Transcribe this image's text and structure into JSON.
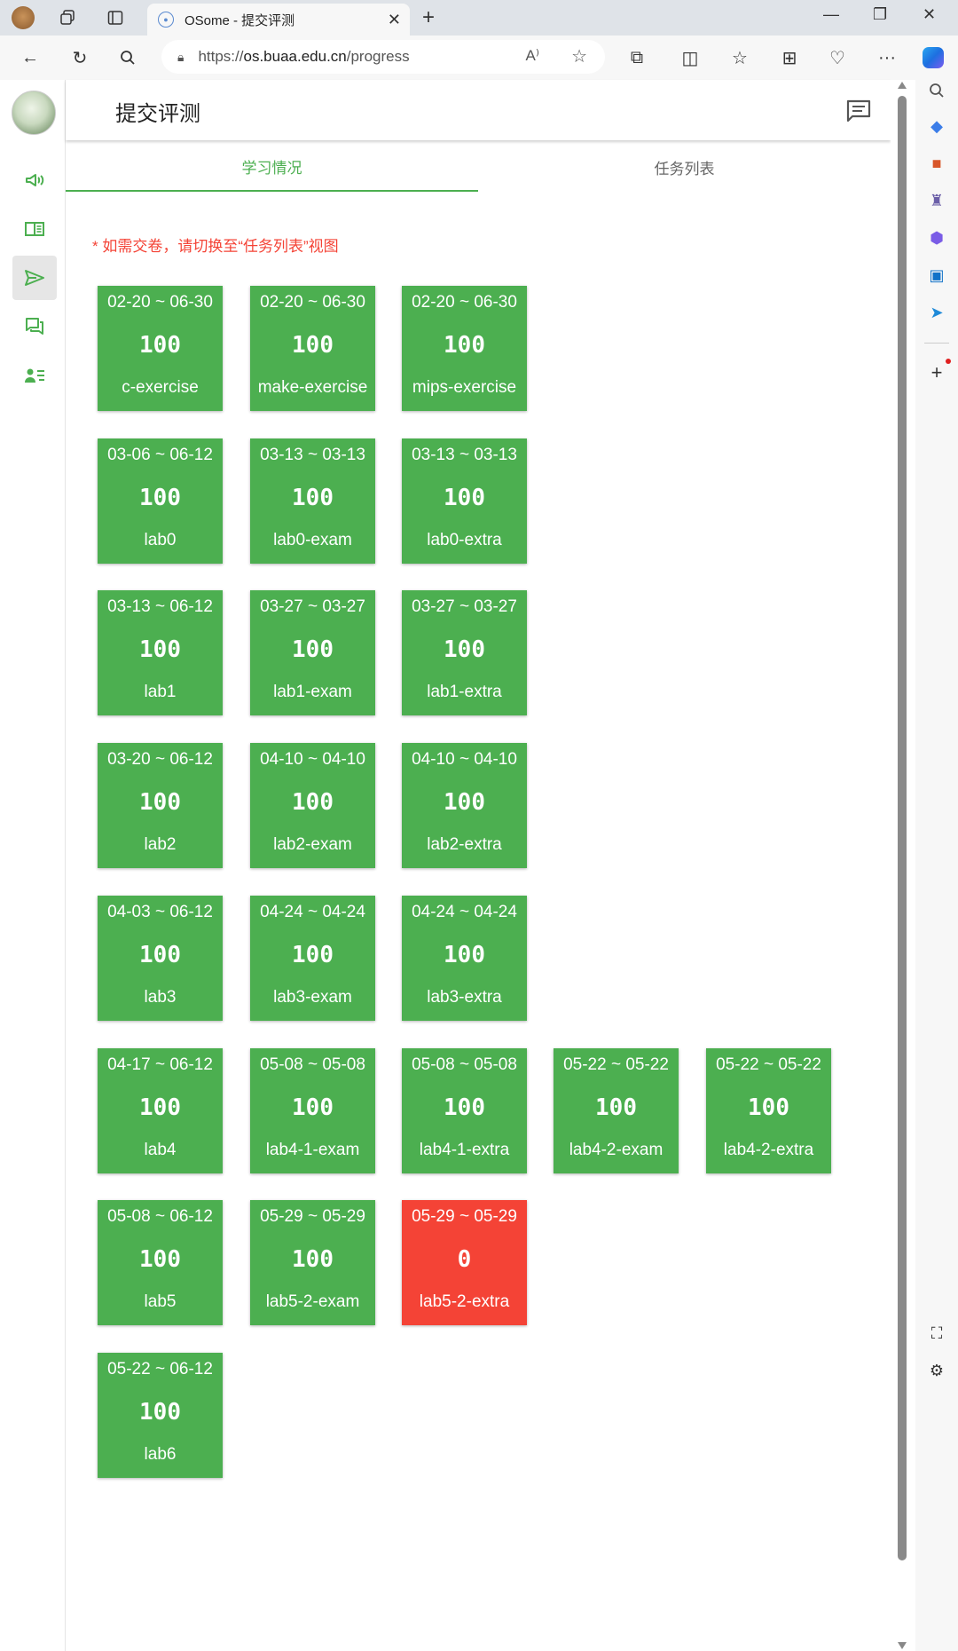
{
  "browser": {
    "tab_title": "OSome - 提交评测",
    "url_prefix": "https://",
    "url_host": "os.buaa.edu.cn",
    "url_path": "/progress"
  },
  "app": {
    "title": "提交评测",
    "tabs": [
      {
        "label": "学习情况",
        "active": true
      },
      {
        "label": "任务列表",
        "active": false
      }
    ],
    "notice": "* 如需交卷，请切换至“任务列表”视图"
  },
  "nav": [
    "announcement-icon",
    "book-icon",
    "send-icon",
    "forum-icon",
    "user-list-icon"
  ],
  "colors": {
    "pass": "#4caf50",
    "fail": "#f44336"
  },
  "cards": [
    {
      "date": "02-20 ~ 06-30",
      "score": "100",
      "name": "c-exercise",
      "status": "pass"
    },
    {
      "date": "02-20 ~ 06-30",
      "score": "100",
      "name": "make-exercise",
      "status": "pass"
    },
    {
      "date": "02-20 ~ 06-30",
      "score": "100",
      "name": "mips-exercise",
      "status": "pass"
    },
    {
      "date": "03-06 ~ 06-12",
      "score": "100",
      "name": "lab0",
      "status": "pass"
    },
    {
      "date": "03-13 ~ 03-13",
      "score": "100",
      "name": "lab0-exam",
      "status": "pass"
    },
    {
      "date": "03-13 ~ 03-13",
      "score": "100",
      "name": "lab0-extra",
      "status": "pass"
    },
    {
      "date": "03-13 ~ 06-12",
      "score": "100",
      "name": "lab1",
      "status": "pass"
    },
    {
      "date": "03-27 ~ 03-27",
      "score": "100",
      "name": "lab1-exam",
      "status": "pass"
    },
    {
      "date": "03-27 ~ 03-27",
      "score": "100",
      "name": "lab1-extra",
      "status": "pass"
    },
    {
      "date": "03-20 ~ 06-12",
      "score": "100",
      "name": "lab2",
      "status": "pass"
    },
    {
      "date": "04-10 ~ 04-10",
      "score": "100",
      "name": "lab2-exam",
      "status": "pass"
    },
    {
      "date": "04-10 ~ 04-10",
      "score": "100",
      "name": "lab2-extra",
      "status": "pass"
    },
    {
      "date": "04-03 ~ 06-12",
      "score": "100",
      "name": "lab3",
      "status": "pass"
    },
    {
      "date": "04-24 ~ 04-24",
      "score": "100",
      "name": "lab3-exam",
      "status": "pass"
    },
    {
      "date": "04-24 ~ 04-24",
      "score": "100",
      "name": "lab3-extra",
      "status": "pass"
    },
    {
      "date": "04-17 ~ 06-12",
      "score": "100",
      "name": "lab4",
      "status": "pass"
    },
    {
      "date": "05-08 ~ 05-08",
      "score": "100",
      "name": "lab4-1-exam",
      "status": "pass"
    },
    {
      "date": "05-08 ~ 05-08",
      "score": "100",
      "name": "lab4-1-extra",
      "status": "pass"
    },
    {
      "date": "05-22 ~ 05-22",
      "score": "100",
      "name": "lab4-2-exam",
      "status": "pass"
    },
    {
      "date": "05-22 ~ 05-22",
      "score": "100",
      "name": "lab4-2-extra",
      "status": "pass"
    },
    {
      "date": "05-08 ~ 06-12",
      "score": "100",
      "name": "lab5",
      "status": "pass"
    },
    {
      "date": "05-29 ~ 05-29",
      "score": "100",
      "name": "lab5-2-exam",
      "status": "pass"
    },
    {
      "date": "05-29 ~ 05-29",
      "score": "0",
      "name": "lab5-2-extra",
      "status": "fail"
    },
    {
      "date": "05-22 ~ 06-12",
      "score": "100",
      "name": "lab6",
      "status": "pass"
    }
  ]
}
